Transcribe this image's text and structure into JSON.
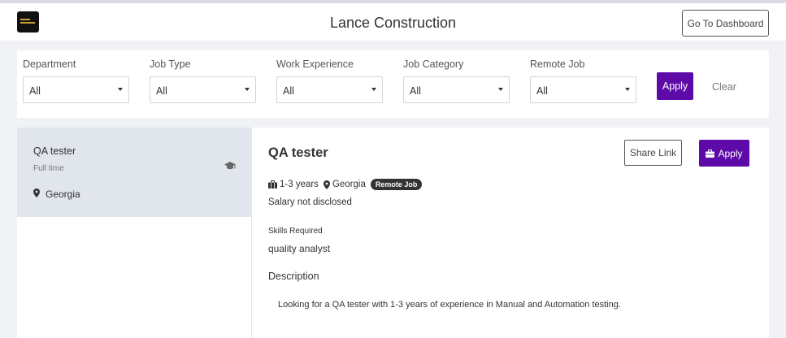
{
  "header": {
    "title": "Lance Construction",
    "dashboard_button": "Go To Dashboard",
    "logo_icon": "company-logo"
  },
  "filters": {
    "items": [
      {
        "label": "Department",
        "value": "All"
      },
      {
        "label": "Job Type",
        "value": "All"
      },
      {
        "label": "Work Experience",
        "value": "All"
      },
      {
        "label": "Job Category",
        "value": "All"
      },
      {
        "label": "Remote Job",
        "value": "All"
      }
    ],
    "apply_label": "Apply",
    "clear_label": "Clear"
  },
  "job_list": [
    {
      "title": "QA tester",
      "type": "Full time",
      "location": "Georgia",
      "icon": "graduation-cap-icon"
    }
  ],
  "detail": {
    "title": "QA tester",
    "share_label": "Share Link",
    "apply_label": "Apply",
    "experience": "1-3 years",
    "location": "Georgia",
    "remote_badge": "Remote Job",
    "salary": "Salary not disclosed",
    "skills_heading": "Skills Required",
    "skills": "quality analyst",
    "description_heading": "Description",
    "description": "Looking for a QA tester with 1-3 years of experience in Manual and Automation testing."
  },
  "colors": {
    "accent": "#5d0aa8",
    "selected_card": "#e1e6ec",
    "page_bg": "#f1f2f5"
  }
}
